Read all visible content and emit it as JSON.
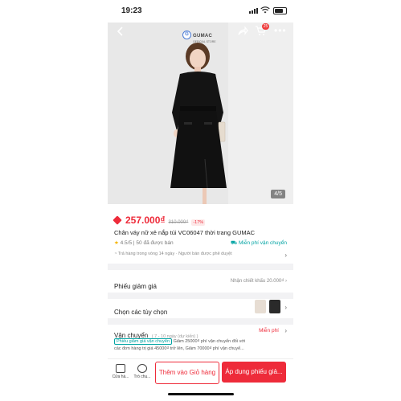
{
  "status": {
    "time": "19:23"
  },
  "header": {
    "brand": "GUMAC",
    "brand_sub": "OFFICIAL STORE",
    "cart_count": "25"
  },
  "gallery": {
    "counter": "4/5"
  },
  "product": {
    "price": "257.000₫",
    "old_price": "310.000₫",
    "discount": "-17%",
    "title": "Chân váy nữ xẻ nắp túi VC06047 thời trang GUMAC",
    "rating": "4.5/5",
    "sold": "50 đã được bán",
    "free_ship": "Miễn phí vận chuyển",
    "policy": "Trả hàng trong vòng 14 ngày · Người bán được phê duyệt"
  },
  "voucher_row": {
    "label": "Phiếu giảm giá",
    "right": "Nhận chiết khấu 20.000₫"
  },
  "options_row": {
    "label": "Chọn các tùy chọn"
  },
  "shipping": {
    "label": "Vận chuyển",
    "range": "( 7 - 10 ngày (dự kiến) )",
    "free": "Miễn phí",
    "voucher_tag": "Phiếu giảm giá vận chuyển",
    "voucher_text_1": "Giảm 25000₫ phí vận chuyển đối với",
    "voucher_text_2": "các đơn hàng trị giá 45000₫ trở lên, Giảm 70000₫ phí vận chuyể..."
  },
  "bottom": {
    "store_label": "Cửa hà...",
    "chat_label": "Trò chu...",
    "add_cart": "Thêm vào Giỏ hàng",
    "buy": "Áp dụng phiếu giả..."
  },
  "colors": {
    "accent": "#ee2b3a",
    "teal": "#00a3a3"
  }
}
